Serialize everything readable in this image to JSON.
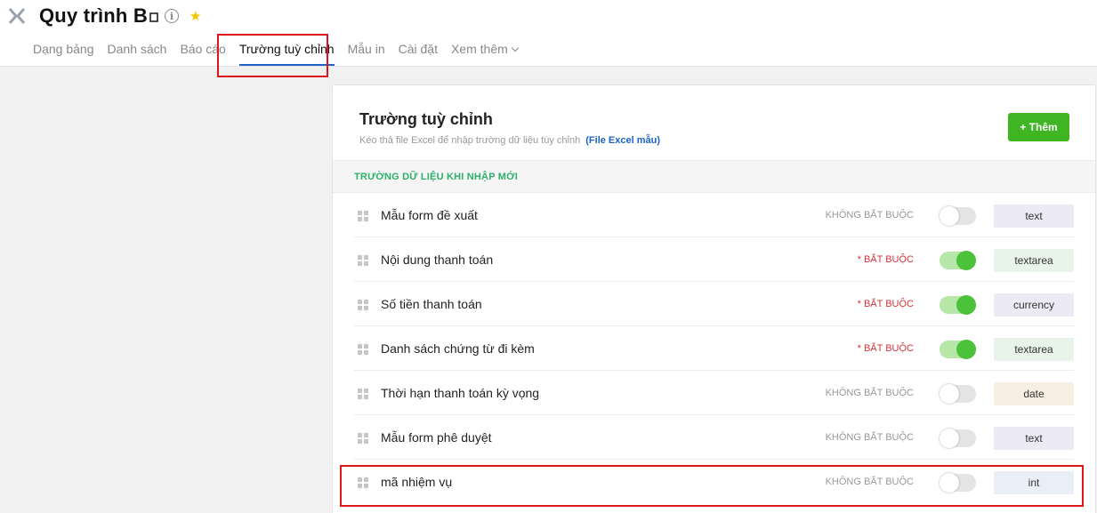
{
  "app": {
    "title": "Quy trình B"
  },
  "tabs": [
    {
      "label": "Dạng bảng",
      "active": false
    },
    {
      "label": "Danh sách",
      "active": false
    },
    {
      "label": "Báo cáo",
      "active": false
    },
    {
      "label": "Trường tuỳ chỉnh",
      "active": true
    },
    {
      "label": "Mẫu in",
      "active": false
    },
    {
      "label": "Cài đặt",
      "active": false
    }
  ],
  "tab_more": "Xem thêm",
  "panel": {
    "title": "Trường tuỳ chỉnh",
    "subtitle": "Kéo thả file Excel để nhập trường dữ liệu tùy chỉnh",
    "subtitle_link": "(File Excel mẫu)",
    "add_label": "+ Thêm",
    "section_title": "TRƯỜNG DỮ LIỆU KHI NHẬP MỚI"
  },
  "fields": [
    {
      "name": "Mẫu form đề xuất",
      "required_label": "KHÔNG BẮT BUỘC",
      "required": false,
      "type": "text",
      "type_color": "#eceaf5"
    },
    {
      "name": "Nội dung thanh toán",
      "required_label": "* BẮT BUỘC",
      "required": true,
      "type": "textarea",
      "type_color": "#e8f3ea"
    },
    {
      "name": "Số tiền thanh toán",
      "required_label": "* BẮT BUỘC",
      "required": true,
      "type": "currency",
      "type_color": "#eceaf5"
    },
    {
      "name": "Danh sách chứng từ đi kèm",
      "required_label": "* BẮT BUỘC",
      "required": true,
      "type": "textarea",
      "type_color": "#e8f3ea"
    },
    {
      "name": "Thời hạn thanh toán kỳ vọng",
      "required_label": "KHÔNG BẮT BUỘC",
      "required": false,
      "type": "date",
      "type_color": "#f7efe3"
    },
    {
      "name": "Mẫu form phê duyệt",
      "required_label": "KHÔNG BẮT BUỘC",
      "required": false,
      "type": "text",
      "type_color": "#eceaf5"
    },
    {
      "name": "mã nhiệm vụ",
      "required_label": "KHÔNG BẮT BUỘC",
      "required": false,
      "type": "int",
      "type_color": "#eaeef6"
    }
  ],
  "colors": {
    "accent_blue": "#1d63c5",
    "add_green": "#3fb523",
    "toggle_on": "#4cc13a",
    "highlight_red": "#e0171a"
  }
}
